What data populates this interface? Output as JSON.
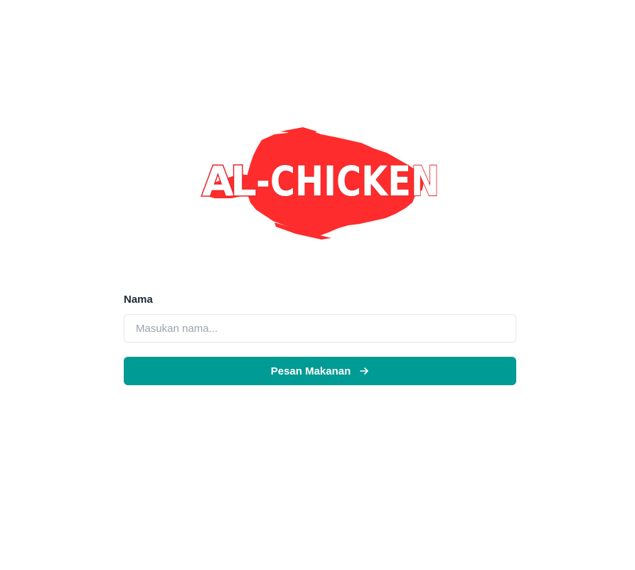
{
  "logo": {
    "text_a": "A",
    "text_l": "L",
    "text_rest": "-CHICKEN",
    "brush_color": "#fe2c2c",
    "letter_fill": "#ffffff",
    "letter_outline": "#e6262b"
  },
  "form": {
    "name_label": "Nama",
    "name_placeholder": "Masukan nama...",
    "name_value": "",
    "submit_label": "Pesan Makanan",
    "submit_icon": "arrow-right-icon",
    "accent_color": "#009b94"
  }
}
